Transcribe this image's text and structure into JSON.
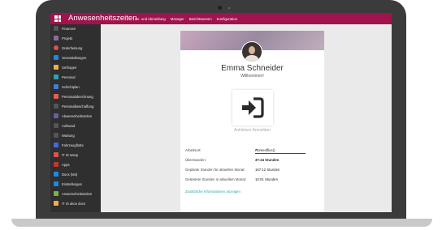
{
  "app": {
    "title": "Anwesenheitszeiten"
  },
  "topnav": {
    "items": [
      "An- und Abmeldung",
      "Manager",
      "Berichtswesen",
      "Konfiguration"
    ]
  },
  "sidebar": {
    "items": [
      {
        "label": "Finanzen",
        "icon": "finance-icon",
        "color": "#555555"
      },
      {
        "label": "Projekt",
        "icon": "project-icon",
        "color": "#8e6c99"
      },
      {
        "label": "Zeiterfassung",
        "icon": "clock-icon",
        "color": "#d9534f"
      },
      {
        "label": "Veranstaltungen",
        "icon": "events-icon",
        "color": "#1e88e5"
      },
      {
        "label": "Umfragen",
        "icon": "survey-icon",
        "color": "#f0ad4e"
      },
      {
        "label": "Personal",
        "icon": "employees-icon",
        "color": "#2e9fb4"
      },
      {
        "label": "Schichtplan",
        "icon": "schedule-icon",
        "color": "#3f7fd6"
      },
      {
        "label": "Personalabrechnung",
        "icon": "payroll-icon",
        "color": "#e65c5c"
      },
      {
        "label": "Personalbeschaffung",
        "icon": "recruitment-icon",
        "color": "#555555"
      },
      {
        "label": "Abwesenheitszeiten",
        "icon": "time-off-icon",
        "color": "#6f5aa7"
      },
      {
        "label": "Aufwand",
        "icon": "expense-icon",
        "color": "#555555"
      },
      {
        "label": "Wartung",
        "icon": "maintenance-icon",
        "color": "#555555"
      },
      {
        "label": "Fahrzeugflotte",
        "icon": "fleet-icon",
        "color": "#3f6ad8"
      },
      {
        "label": "IT IS setup",
        "icon": "setup-icon",
        "color": "#d9534f"
      },
      {
        "label": "Apps",
        "icon": "apps-icon",
        "color": "#c0392b"
      },
      {
        "label": "Docs (M4)",
        "icon": "docs-icon",
        "color": "#1e88e5"
      },
      {
        "label": "Einstellungen",
        "icon": "settings-icon",
        "color": "#1e88e5"
      },
      {
        "label": "Anwesenheitszeiten",
        "icon": "attendance-icon",
        "color": "#7cb342"
      },
      {
        "label": "IT IS akon docs",
        "icon": "docs-icon",
        "color": "#f0ad4e"
      }
    ]
  },
  "card": {
    "name": "Emma Schneider",
    "welcome": "Willkommen!",
    "checkin_label": "Anklicken Anmelden",
    "fields": [
      {
        "label": "Arbeitsort:",
        "value": "Homeoffice()"
      },
      {
        "label": "Überstunden:",
        "value": "37:24 Stunden"
      },
      {
        "label": "Geplante Stunden für aktuellen Monat:",
        "value": "167:12 Stunden"
      },
      {
        "label": "Geleistete Stunden in aktuellem Monat:",
        "value": "10:01 Stunden"
      }
    ],
    "link": "Zusätzliche Informationen anzeigen"
  },
  "colors": {
    "accent": "#a0134e",
    "sidebar": "#2f2f2f",
    "link": "#2aa6a6"
  }
}
